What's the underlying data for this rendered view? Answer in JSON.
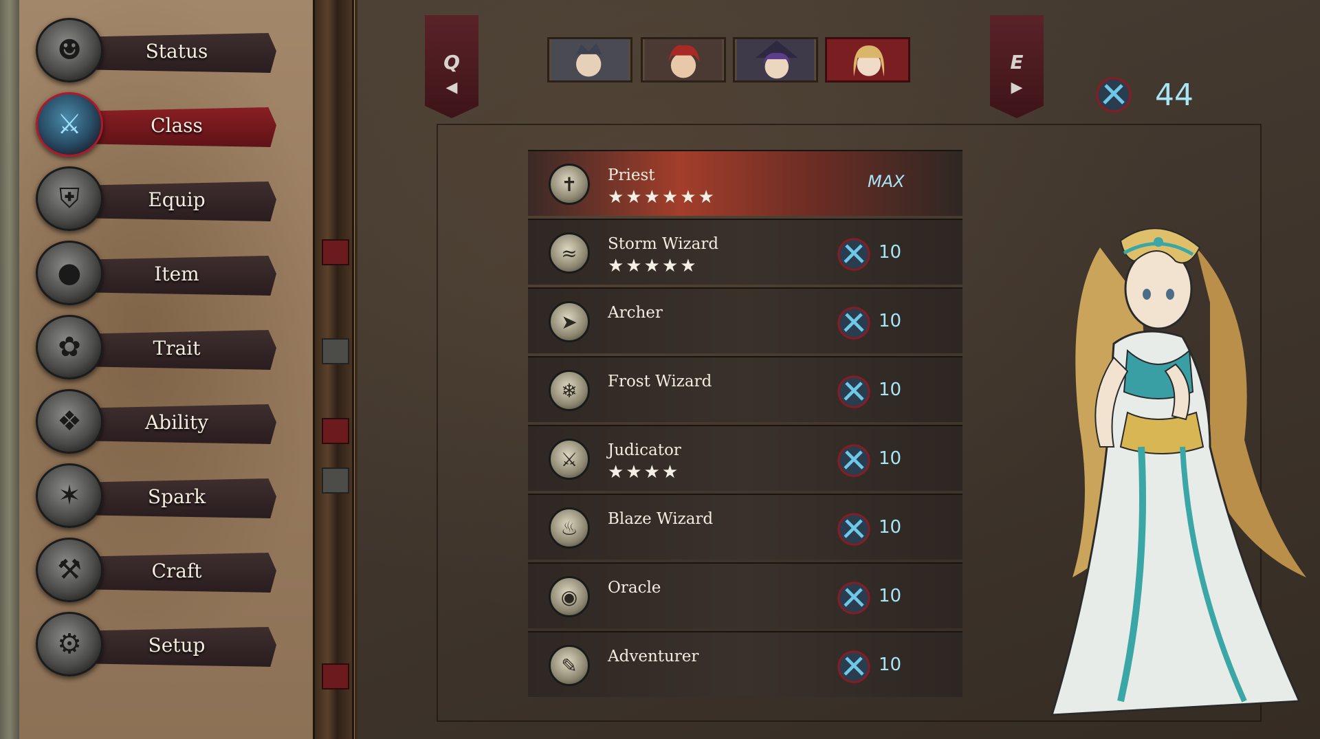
{
  "menu": {
    "items": [
      {
        "label": "Status",
        "icon": "silhouette-icon"
      },
      {
        "label": "Class",
        "icon": "crossed-swords-icon"
      },
      {
        "label": "Equip",
        "icon": "armor-icon"
      },
      {
        "label": "Item",
        "icon": "pouch-icon"
      },
      {
        "label": "Trait",
        "icon": "rose-icon"
      },
      {
        "label": "Ability",
        "icon": "tangle-icon"
      },
      {
        "label": "Spark",
        "icon": "spark-icon"
      },
      {
        "label": "Craft",
        "icon": "hammer-icon"
      },
      {
        "label": "Setup",
        "icon": "gear-icon"
      }
    ],
    "active": "Class"
  },
  "party_nav": {
    "prev_key": "Q",
    "next_key": "E",
    "selected_index": 3
  },
  "currency": {
    "value": "44",
    "icon": "class-point-icon"
  },
  "classes": [
    {
      "name": "Priest",
      "stars": "★★★★★★",
      "cost": "",
      "status": "MAX",
      "icon": "cross-icon"
    },
    {
      "name": "Storm Wizard",
      "stars": "★★★★★",
      "cost": "10",
      "status": "",
      "icon": "tornado-icon"
    },
    {
      "name": "Archer",
      "stars": "",
      "cost": "10",
      "status": "",
      "icon": "bow-icon"
    },
    {
      "name": "Frost Wizard",
      "stars": "",
      "cost": "10",
      "status": "",
      "icon": "snowflake-icon"
    },
    {
      "name": "Judicator",
      "stars": "★★★★",
      "cost": "10",
      "status": "",
      "icon": "sword-shield-icon"
    },
    {
      "name": "Blaze Wizard",
      "stars": "",
      "cost": "10",
      "status": "",
      "icon": "flame-icon"
    },
    {
      "name": "Oracle",
      "stars": "",
      "cost": "10",
      "status": "",
      "icon": "eye-icon"
    },
    {
      "name": "Adventurer",
      "stars": "",
      "cost": "10",
      "status": "",
      "icon": "map-icon"
    }
  ],
  "colors": {
    "accent_red": "#8a1f24",
    "cyan_text": "#a9e6f5",
    "parchment": "#9a7d60"
  }
}
